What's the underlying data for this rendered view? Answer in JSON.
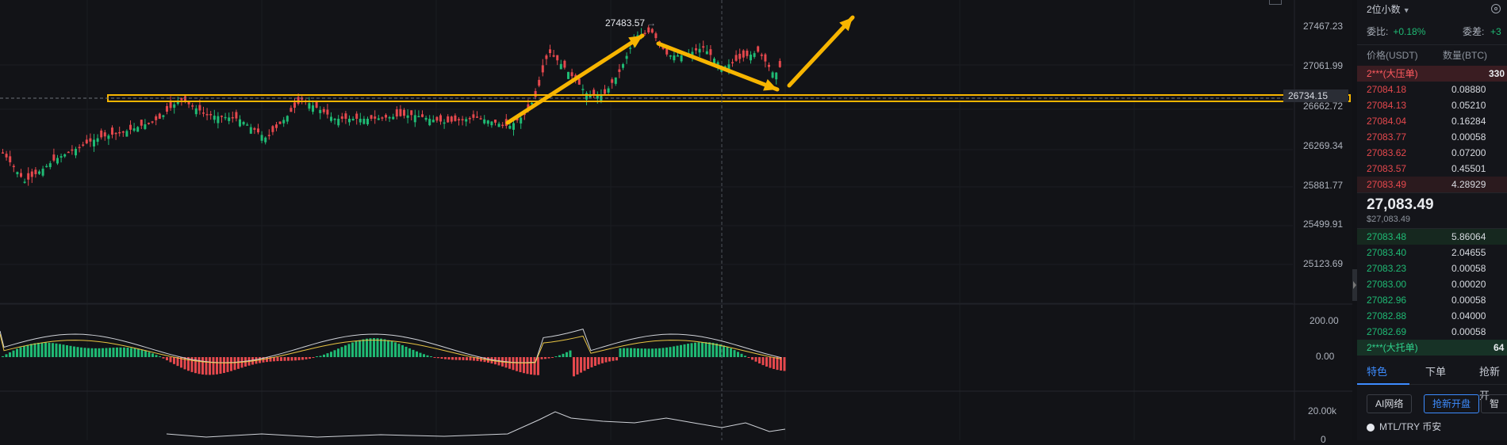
{
  "chart": {
    "price_axis_labels": [
      "27467.23",
      "27061.99",
      "26662.72",
      "26269.34",
      "25881.77",
      "25499.91",
      "25123.69"
    ],
    "current_price_marker": "26734.15",
    "peak_label": "27483.57",
    "peak_arrow": "→",
    "macd_axis_labels": [
      "200.00",
      "0.00"
    ],
    "volume_axis_labels": [
      "20.00k",
      "0"
    ],
    "colors": {
      "up": "#1fba74",
      "down": "#e5484d",
      "arrow": "#f7b500",
      "support_box": "#f7b500"
    }
  },
  "orderbook": {
    "precision_label": "2位小数",
    "ratio_label": "委比:",
    "ratio_value": "+0.18%",
    "diff_label": "委差:",
    "diff_value": "+3",
    "col_price": "价格(USDT)",
    "col_qty": "数量(BTC)",
    "ask_total": {
      "label": "2***(大压单)",
      "qty": "330"
    },
    "asks": [
      {
        "price": "27084.18",
        "qty": "0.08880"
      },
      {
        "price": "27084.13",
        "qty": "0.05210"
      },
      {
        "price": "27084.04",
        "qty": "0.16284"
      },
      {
        "price": "27083.77",
        "qty": "0.00058"
      },
      {
        "price": "27083.62",
        "qty": "0.07200"
      },
      {
        "price": "27083.57",
        "qty": "0.45501"
      },
      {
        "price": "27083.49",
        "qty": "4.28929"
      }
    ],
    "last_price": "27,083.49",
    "last_price_usd": "$27,083.49",
    "bids": [
      {
        "price": "27083.48",
        "qty": "5.86064"
      },
      {
        "price": "27083.40",
        "qty": "2.04655"
      },
      {
        "price": "27083.23",
        "qty": "0.00058"
      },
      {
        "price": "27083.00",
        "qty": "0.00020"
      },
      {
        "price": "27082.96",
        "qty": "0.00058"
      },
      {
        "price": "27082.88",
        "qty": "0.04000"
      },
      {
        "price": "27082.69",
        "qty": "0.00058"
      }
    ],
    "bid_total": {
      "label": "2***(大托单)",
      "qty": "64"
    },
    "tabs": [
      "特色",
      "下单",
      "抢新开"
    ],
    "buttons": [
      "AI网络",
      "抢新开盘",
      "智"
    ],
    "bottom_item": "MTL/TRY  币安"
  }
}
